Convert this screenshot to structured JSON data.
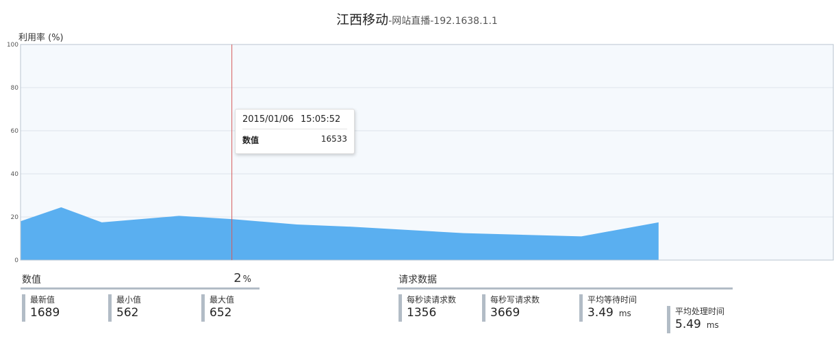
{
  "title": {
    "main": "江西移动",
    "sub": "-网站直播-192.1638.1.1"
  },
  "chart_data": {
    "type": "area",
    "ylabel": "利用率 (%)",
    "ylim": [
      0,
      100
    ],
    "yticks": [
      0,
      20,
      40,
      60,
      80,
      100
    ],
    "grid": true,
    "fill_color": "#5aaff0",
    "plot_bg": "#f5f9fd",
    "series": [
      {
        "values": [
          18,
          24.5,
          17.5,
          20.5,
          19,
          16.5,
          15.5,
          14,
          12.5,
          11,
          17.5
        ]
      }
    ],
    "x_steps": [
      0,
      1,
      2,
      3.9,
      5.2,
      6.8,
      8.1,
      9.5,
      10.9,
      13.8,
      15.7
    ],
    "x_steps_total": 20,
    "crosshair_color": "#d55a5a"
  },
  "crosshair_step": 5.2,
  "tooltip": {
    "date": "2015/01/06",
    "time": "15:05:52",
    "label": "数值",
    "value": "16533"
  },
  "left_panel": {
    "title": "数值",
    "percent": "2",
    "percent_unit": "%",
    "metrics": [
      {
        "label": "最新值",
        "value": "1689"
      },
      {
        "label": "最小值",
        "value": "562"
      },
      {
        "label": "最大值",
        "value": "652"
      }
    ]
  },
  "right_panel": {
    "title": "请求数据",
    "metrics": [
      {
        "label": "每秒读请求数",
        "value": "1356",
        "unit": ""
      },
      {
        "label": "每秒写请求数",
        "value": "3669",
        "unit": ""
      },
      {
        "label": "平均等待时间",
        "value": "3.49",
        "unit": "ms"
      },
      {
        "label": "平均处理时间",
        "value": "5.49",
        "unit": "ms"
      }
    ]
  }
}
